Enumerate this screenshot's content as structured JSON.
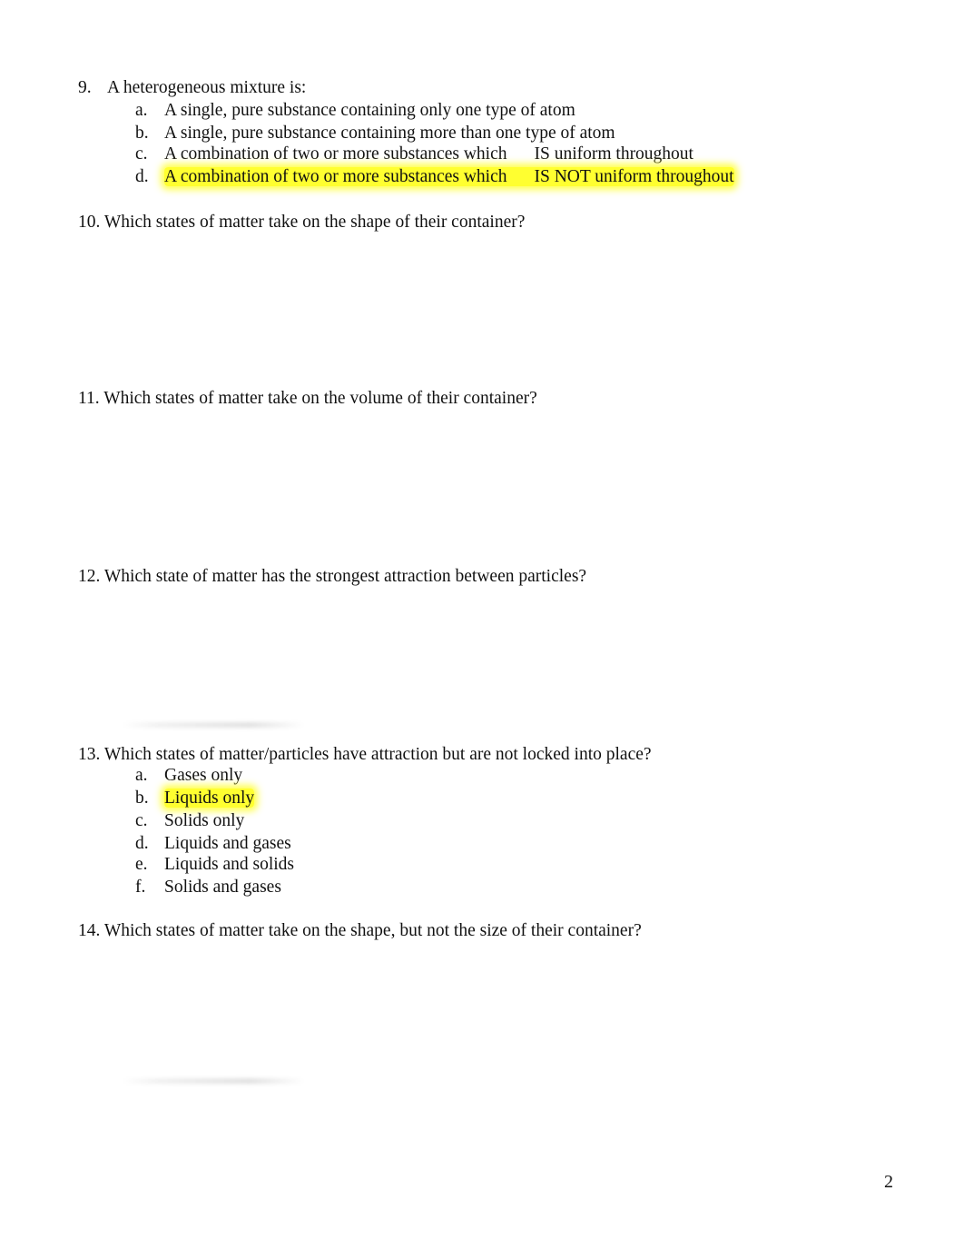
{
  "questions": [
    {
      "number": "9.",
      "text": "A heterogeneous mixture is:",
      "options": [
        {
          "letter": "a.",
          "text": "A single, pure substance containing only one type of atom",
          "highlighted": false
        },
        {
          "letter": "b.",
          "text": "A single, pure substance containing more than one type of atom",
          "highlighted": false
        },
        {
          "letter": "c.",
          "text": "A combination of two or more substances which",
          "text2": "IS uniform throughout",
          "highlighted": false
        },
        {
          "letter": "d.",
          "text": "A combination of two or more substances which",
          "text2": "IS NOT uniform throughout",
          "highlighted": true
        }
      ]
    },
    {
      "number": "10.",
      "text": "Which states of matter take on the shape of their container?"
    },
    {
      "number": "11.",
      "text": "Which states of matter take on the volume of their container?"
    },
    {
      "number": "12.",
      "text": "Which state of matter has the strongest attraction between particles?"
    },
    {
      "number": "13.",
      "text": "Which states of matter/particles have attraction but are not locked into place?",
      "options": [
        {
          "letter": "a.",
          "text": "Gases only",
          "highlighted": false
        },
        {
          "letter": "b.",
          "text": "Liquids only",
          "highlighted": true
        },
        {
          "letter": "c.",
          "text": "Solids only",
          "highlighted": false
        },
        {
          "letter": "d.",
          "text": "Liquids and gases",
          "highlighted": false
        },
        {
          "letter": "e.",
          "text": "Liquids and solids",
          "highlighted": false
        },
        {
          "letter": "f.",
          "text": "Solids and gases",
          "highlighted": false
        }
      ]
    },
    {
      "number": "14.",
      "text": "Which states of matter take on the shape, but not the size of their container?"
    }
  ],
  "highlight_color": "#ffff30",
  "page_number": "2"
}
